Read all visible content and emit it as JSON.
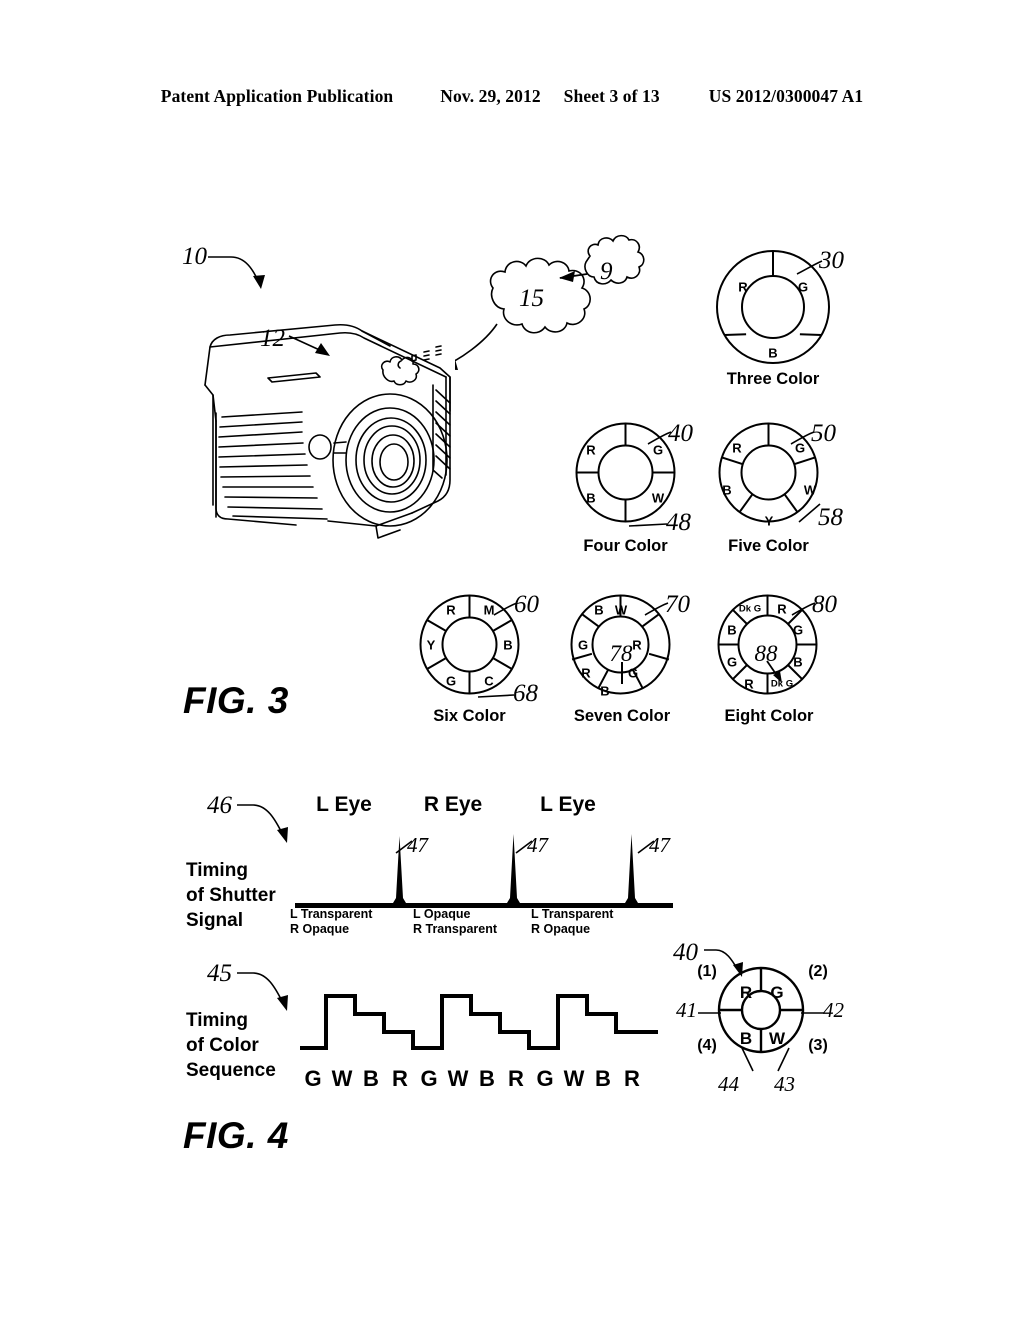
{
  "header": {
    "publication": "Patent Application Publication",
    "date": "Nov. 29, 2012",
    "sheet": "Sheet 3 of 13",
    "patent_number": "US 2012/0300047 A1"
  },
  "figure3": {
    "label": "FIG. 3",
    "projector": {
      "ref_device": "10",
      "ref_housing": "12",
      "ref_cloud_large": "15",
      "ref_cloud_small": "9"
    },
    "wheels": [
      {
        "id": "three-color",
        "caption": "Three Color",
        "ref": "30",
        "hub": "",
        "segments": [
          "R",
          "G",
          "B"
        ]
      },
      {
        "id": "four-color",
        "caption": "Four Color",
        "ref": "40",
        "ref2": "48",
        "hub": "",
        "segments": [
          "R",
          "G",
          "W",
          "B"
        ]
      },
      {
        "id": "five-color",
        "caption": "Five Color",
        "ref": "50",
        "ref2": "58",
        "hub": "",
        "segments": [
          "R",
          "G",
          "W",
          "Y",
          "B"
        ]
      },
      {
        "id": "six-color",
        "caption": "Six Color",
        "ref": "60",
        "ref2": "68",
        "hub": "",
        "segments": [
          "R",
          "M",
          "B",
          "C",
          "G",
          "Y"
        ]
      },
      {
        "id": "seven-color",
        "caption": "Seven Color",
        "ref": "70",
        "hub": "78",
        "segments": [
          "R",
          "G",
          "B",
          "W",
          "R",
          "G",
          "B"
        ]
      },
      {
        "id": "eight-color",
        "caption": "Eight Color",
        "ref": "80",
        "hub": "88",
        "segments": [
          "R",
          "G",
          "B",
          "Dk G",
          "R",
          "G",
          "B",
          "Dk G"
        ]
      }
    ]
  },
  "figure4": {
    "label": "FIG. 4",
    "shutter": {
      "ref": "46",
      "title_lines": [
        "Timing",
        "of Shutter",
        "Signal"
      ],
      "eye_labels": [
        "L Eye",
        "R Eye",
        "L Eye"
      ],
      "spike_refs": [
        "47",
        "47",
        "47"
      ],
      "states": [
        {
          "line1": "L Transparent",
          "line2": "R Opaque"
        },
        {
          "line1": "L Opaque",
          "line2": "R Transparent"
        },
        {
          "line1": "L Transparent",
          "line2": "R Opaque"
        }
      ]
    },
    "sequence": {
      "ref": "45",
      "title_lines": [
        "Timing",
        "of Color",
        "Sequence"
      ],
      "letters": [
        "G",
        "W",
        "B",
        "R",
        "G",
        "W",
        "B",
        "R",
        "G",
        "W",
        "B",
        "R"
      ],
      "levels": [
        0,
        3,
        2,
        1,
        0,
        3,
        2,
        1,
        0,
        3,
        2,
        1
      ]
    },
    "wheel": {
      "ref": "40",
      "segments": [
        {
          "label": "R",
          "index": "(1)",
          "ref": "41"
        },
        {
          "label": "G",
          "index": "(2)",
          "ref": "42"
        },
        {
          "label": "W",
          "index": "(3)",
          "ref": "43"
        },
        {
          "label": "B",
          "index": "(4)",
          "ref": "44"
        }
      ]
    }
  },
  "chart_data": {
    "type": "line",
    "title": "Timing of Shutter Signal and Timing of Color Sequence",
    "series": [
      {
        "name": "Timing of Shutter Signal",
        "type": "pulse",
        "baseline": 0,
        "pulse_positions": [
          0.29,
          0.6,
          0.9
        ],
        "pulse_height": 1,
        "segment_labels": [
          "L Eye",
          "R Eye",
          "L Eye"
        ]
      },
      {
        "name": "Timing of Color Sequence",
        "type": "step",
        "x": [
          "G",
          "W",
          "B",
          "R",
          "G",
          "W",
          "B",
          "R",
          "G",
          "W",
          "B",
          "R"
        ],
        "values": [
          0,
          3,
          2,
          1,
          0,
          3,
          2,
          1,
          0,
          3,
          2,
          1
        ]
      }
    ],
    "xlabel": "",
    "ylabel": "",
    "grid": false,
    "legend": "none"
  }
}
